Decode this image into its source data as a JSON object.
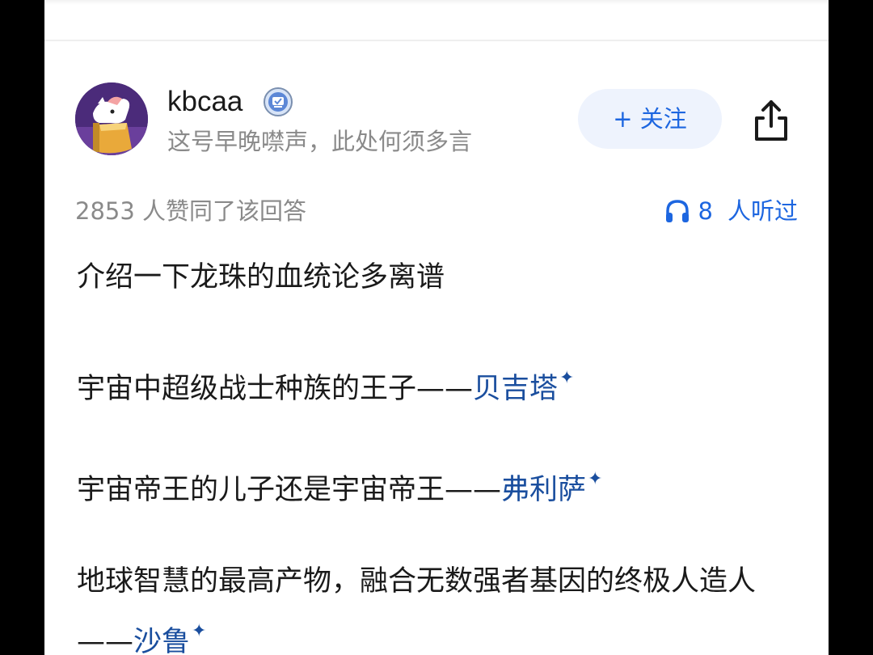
{
  "author": {
    "name": "kbcaa",
    "bio": "这号早晚噤声，此处何须多言"
  },
  "actions": {
    "follow_label": "+ 关注"
  },
  "stats": {
    "agree": "2853  人赞同了该回答",
    "listen_count": "8",
    "listen_label": "人听过"
  },
  "content": {
    "p1": "介绍一下龙珠的血统论多离谱",
    "p2_text": "宇宙中超级战士种族的王子——",
    "p2_link": "贝吉塔",
    "p3_text": "宇宙帝王的儿子还是宇宙帝王——",
    "p3_link": "弗利萨",
    "p4_text": "地球智慧的最高产物，融合无数强者基因的终极人造人——",
    "p4_link": "沙鲁",
    "spark": "✦"
  },
  "icons": {
    "verified": "verified-badge-icon",
    "share": "share-icon",
    "listen": "headphones-icon"
  },
  "colors": {
    "accent": "#1d66e0",
    "link": "#1a4e9e",
    "follow_bg": "#eef3fd"
  }
}
